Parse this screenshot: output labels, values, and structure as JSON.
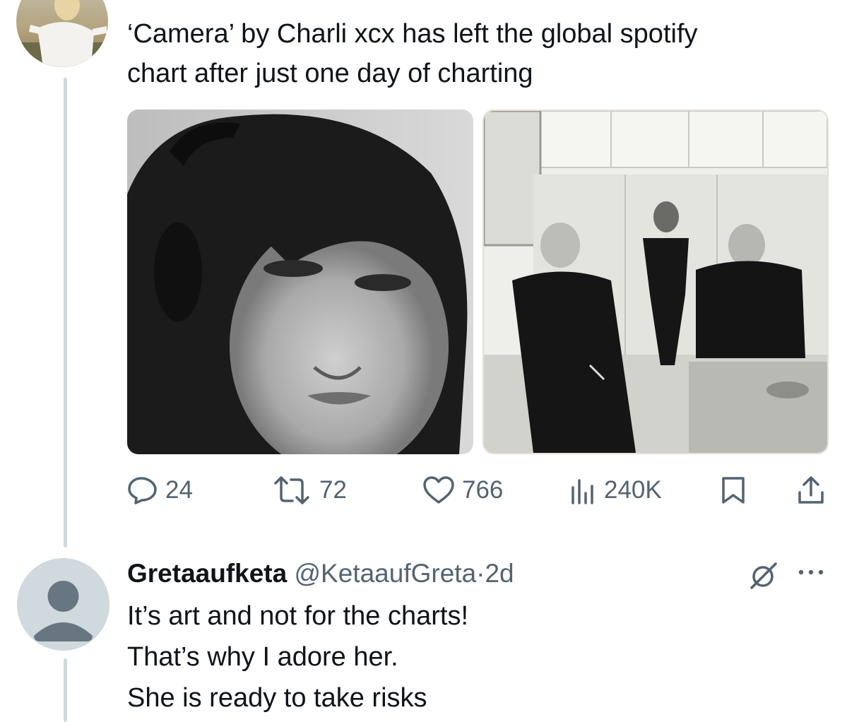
{
  "tweet": {
    "text_line1": "‘Camera’ by Charli xcx has left the global spotify",
    "text_line2": "chart after just one day of charting",
    "actions": {
      "replies": "24",
      "reposts": "72",
      "likes": "766",
      "views": "240K"
    }
  },
  "reply": {
    "display_name": "Gretaaufketa",
    "handle": "@KetaaufGreta",
    "separator": "·",
    "time": "2d",
    "lines": [
      "It’s art and not for the charts!",
      "That’s why I adore her.",
      "She is ready to take risks"
    ]
  },
  "icons": [
    "close-icon",
    "reply-icon",
    "repost-icon",
    "like-icon",
    "views-icon",
    "bookmark-icon",
    "share-icon",
    "grok-icon",
    "more-icon",
    "default-avatar-icon"
  ],
  "colors": {
    "text": "#0f1419",
    "secondary": "#536471",
    "thread_line": "#cfd9de",
    "default_avatar_bg": "#cfd9de",
    "default_avatar_fg": "#687682"
  }
}
